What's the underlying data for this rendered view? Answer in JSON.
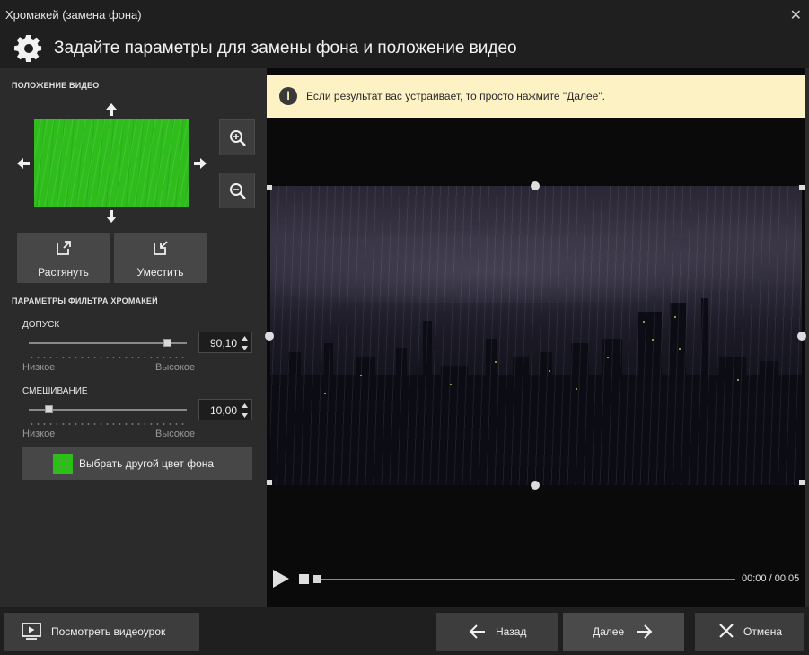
{
  "window": {
    "title": "Хромакей (замена фона)",
    "close_symbol": "✕"
  },
  "header": {
    "title": "Задайте параметры для замены фона и положение видео",
    "icon": "gear-icon"
  },
  "position": {
    "section_title": "ПОЛОЖЕНИЕ ВИДЕО",
    "stretch_label": "Растянуть",
    "fit_label": "Уместить",
    "preview_color": "#2fbd1c"
  },
  "filter": {
    "section_title": "ПАРАМЕТРЫ ФИЛЬТРА ХРОМАКЕЙ",
    "tolerance": {
      "label": "ДОПУСК",
      "value": "90,10",
      "low": "Низкое",
      "high": "Высокое",
      "level": 0.9
    },
    "blend": {
      "label": "СМЕШИВАНИЕ",
      "value": "10,00",
      "low": "Низкое",
      "high": "Высокое",
      "level": 0.1
    },
    "color_button_label": "Выбрать другой цвет фона",
    "key_color": "#2fbd1c"
  },
  "banner": {
    "text": "Если результат вас устраивает, то просто нажмите \"Далее\".",
    "icon": "info-icon"
  },
  "player": {
    "time": "00:00 / 00:05",
    "progress": 0
  },
  "footer": {
    "tutorial_label": "Посмотреть видеоурок",
    "back_label": "Назад",
    "next_label": "Далее",
    "cancel_label": "Отмена"
  }
}
